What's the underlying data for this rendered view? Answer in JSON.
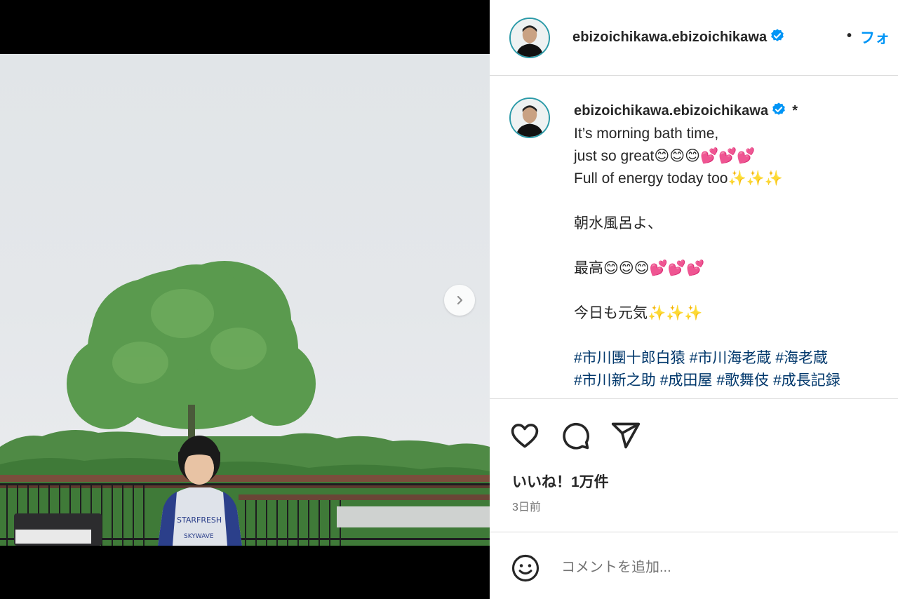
{
  "post": {
    "username": "ebizoichikawa.ebizoichikawa",
    "follow_label": "フォ",
    "separator": "•",
    "verified_color": "#0095f6"
  },
  "caption": {
    "username": "ebizoichikawa.ebizoichikawa",
    "marker": "*",
    "lines_en": [
      "It’s morning bath time,",
      "just so great😊😊😊💕💕💕",
      "Full of energy today too✨✨✨"
    ],
    "line_ja_1": "朝水風呂よ、",
    "line_ja_2": "最高😊😊😊💕💕💕",
    "line_ja_3": "今日も元気✨✨✨",
    "hashtags_row1": [
      "#市川團十郎白猿",
      "#市川海老蔵",
      "#海老蔵"
    ],
    "hashtags_row2": [
      "#市川新之助",
      "#成田屋",
      "#歌舞伎",
      "#成長記録"
    ]
  },
  "actions": {
    "like_icon": "heart-icon",
    "comment_icon": "comment-bubble-icon",
    "share_icon": "paper-plane-icon",
    "likes_text": "いいね！1万件",
    "time_text": "3日前"
  },
  "comment": {
    "emoji_icon": "smiley-icon",
    "placeholder": "コメントを追加..."
  },
  "media": {
    "next_icon": "chevron-right-icon"
  }
}
